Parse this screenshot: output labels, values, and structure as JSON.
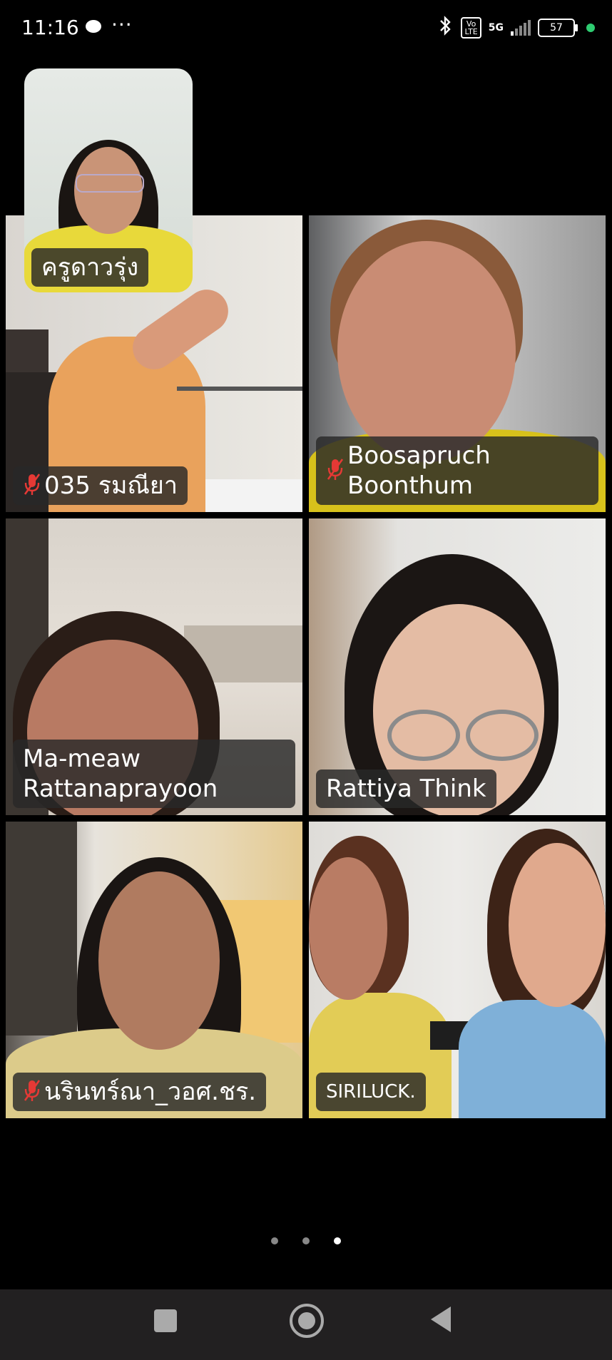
{
  "status_bar": {
    "time": "11:16",
    "more": "···",
    "network_badge": "Vo\nLTE",
    "network_type": "5G",
    "battery_level": "57"
  },
  "self_view": {
    "name": "ครูดาวรุ่ง"
  },
  "participants": [
    {
      "name": "035 รมณียา",
      "muted": true
    },
    {
      "name": "Boosapruch Boonthum",
      "muted": true
    },
    {
      "name": "Ma-meaw Rattanaprayoon",
      "muted": false,
      "active_speaker": true
    },
    {
      "name": "Rattiya Think",
      "muted": false
    },
    {
      "name": "นรินทร์ณา_วอศ.ชร.",
      "muted": true
    },
    {
      "name": "SIRILUCK.",
      "muted": false
    }
  ],
  "pager": {
    "pages": 3,
    "current": 3
  },
  "colors": {
    "active_border": "#2ecc40",
    "muted_icon": "#e53935",
    "battery_dot": "#2ecc71"
  }
}
